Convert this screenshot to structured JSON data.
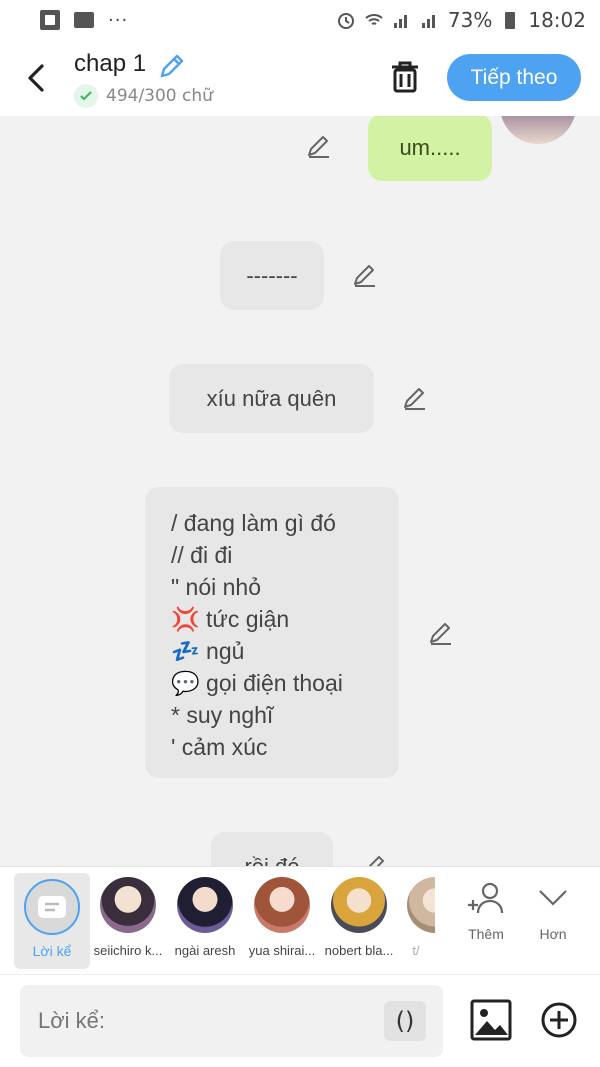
{
  "status_bar": {
    "battery": "73%",
    "time": "18:02",
    "more": "···"
  },
  "header": {
    "title": "chap 1",
    "word_count": "494/300 chữ",
    "next_label": "Tiếp theo"
  },
  "messages": [
    {
      "text": "um.....",
      "side": "right",
      "color": "#d4f2a3"
    },
    {
      "text": "-------",
      "side": "narration"
    },
    {
      "text": "xíu nữa quên",
      "side": "narration"
    },
    {
      "lines": [
        "/ đang làm gì đó",
        "// đi đi",
        "\" nói nhỏ",
        "💢 tức giận",
        "💤 ngủ",
        "💬 gọi điện thoại",
        "* suy nghĩ",
        "' cảm xúc"
      ],
      "side": "narration"
    },
    {
      "text": "rồi đó",
      "side": "narration"
    }
  ],
  "characters": {
    "narrator_label": "Lời kể",
    "list": [
      "seiichiro k...",
      "ngài aresh",
      "yua shirai...",
      "nobert bla...",
      "t/"
    ],
    "add_label": "Thêm",
    "more_label": "Hơn"
  },
  "input": {
    "placeholder": "Lời kể:",
    "paren": "()"
  },
  "colors": {
    "accent": "#4da3f2",
    "bubble_right": "#d4f2a3",
    "bubble_narration": "#e7e7e7"
  }
}
